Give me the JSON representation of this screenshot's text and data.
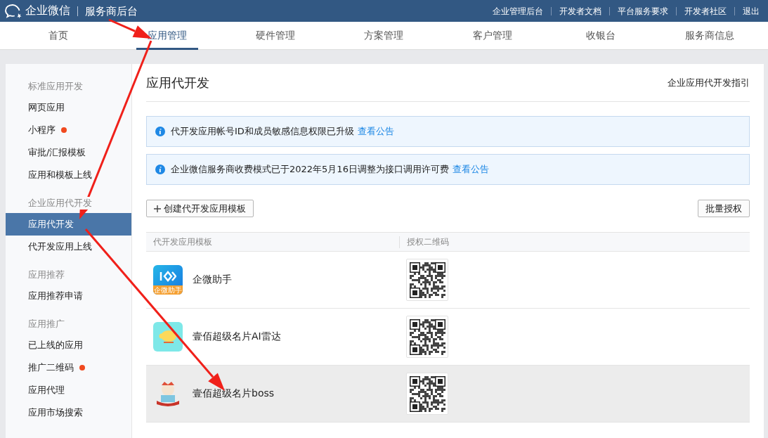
{
  "topbar": {
    "brand": "企业微信",
    "subtitle": "服务商后台",
    "links": [
      "企业管理后台",
      "开发者文档",
      "平台服务要求",
      "开发者社区",
      "退出"
    ]
  },
  "nav": [
    {
      "label": "首页",
      "selected": false
    },
    {
      "label": "应用管理",
      "selected": true
    },
    {
      "label": "硬件管理",
      "selected": false
    },
    {
      "label": "方案管理",
      "selected": false
    },
    {
      "label": "客户管理",
      "selected": false
    },
    {
      "label": "收银台",
      "selected": false
    },
    {
      "label": "服务商信息",
      "selected": false
    }
  ],
  "sidebar": [
    {
      "title": "标准应用开发",
      "items": [
        {
          "label": "网页应用",
          "selected": false,
          "badge": false
        },
        {
          "label": "小程序",
          "selected": false,
          "badge": true
        },
        {
          "label": "审批/汇报模板",
          "selected": false,
          "badge": false
        },
        {
          "label": "应用和模板上线",
          "selected": false,
          "badge": false
        }
      ]
    },
    {
      "title": "企业应用代开发",
      "items": [
        {
          "label": "应用代开发",
          "selected": true,
          "badge": false
        },
        {
          "label": "代开发应用上线",
          "selected": false,
          "badge": false
        }
      ]
    },
    {
      "title": "应用推荐",
      "items": [
        {
          "label": "应用推荐申请",
          "selected": false,
          "badge": false
        }
      ]
    },
    {
      "title": "应用推广",
      "items": [
        {
          "label": "已上线的应用",
          "selected": false,
          "badge": false
        },
        {
          "label": "推广二维码",
          "selected": false,
          "badge": true
        },
        {
          "label": "应用代理",
          "selected": false,
          "badge": false
        },
        {
          "label": "应用市场搜索",
          "selected": false,
          "badge": false
        }
      ]
    }
  ],
  "main": {
    "title": "应用代开发",
    "guide_link": "企业应用代开发指引",
    "notices": [
      {
        "text": "代开发应用帐号ID和成员敏感信息权限已升级",
        "link": "查看公告"
      },
      {
        "text": "企业微信服务商收费模式已于2022年5月16日调整为接口调用许可费",
        "link": "查看公告"
      }
    ],
    "create_button": "创建代开发应用模板",
    "batch_button": "批量授权",
    "table": {
      "columns": [
        "代开发应用模板",
        "授权二维码"
      ],
      "rows": [
        {
          "name": "企微助手",
          "kind": "blue",
          "icon_label": "企微助手",
          "selected": false
        },
        {
          "name": "壹佰超级名片AI雷达",
          "kind": "pig",
          "selected": false
        },
        {
          "name": "壹佰超级名片boss",
          "kind": "mascot",
          "selected": true
        }
      ]
    }
  }
}
